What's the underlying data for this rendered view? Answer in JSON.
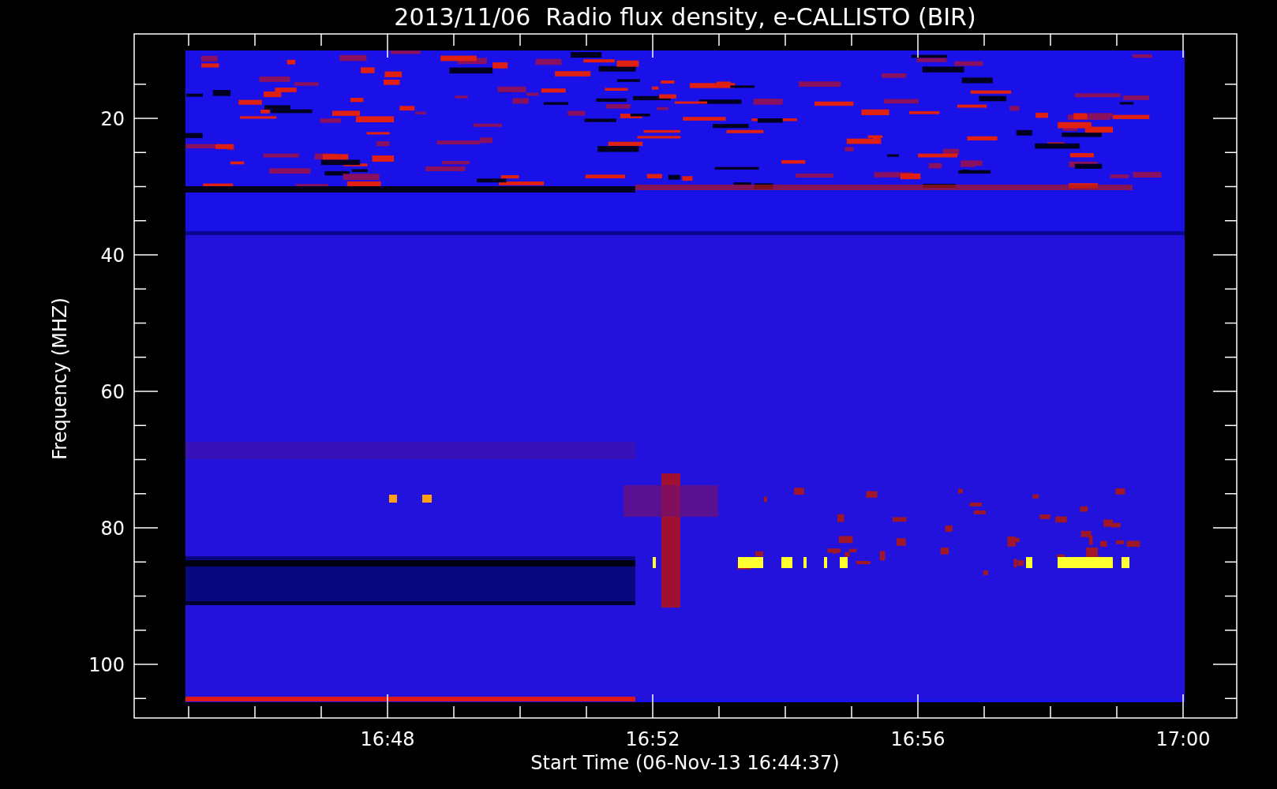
{
  "plot": {
    "title": "2013/11/06  Radio flux density, e-CALLISTO (BIR)",
    "ylabel": "Frequency (MHZ)",
    "xlabel": "Start Time (06-Nov-13 16:44:37)",
    "yticks": [
      "20",
      "40",
      "60",
      "80",
      "100"
    ],
    "xticks": [
      "16:48",
      "16:52",
      "16:56",
      "17:00"
    ]
  }
}
